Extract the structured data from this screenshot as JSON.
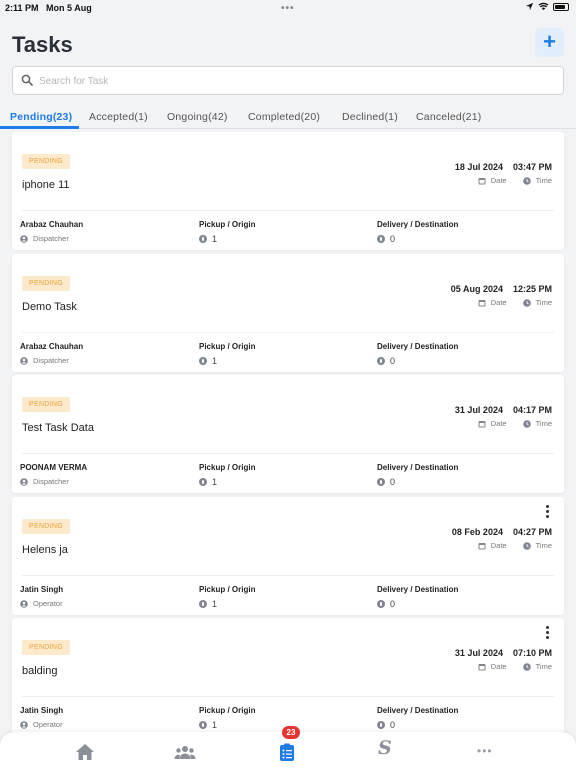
{
  "status_bar": {
    "time": "2:11 PM",
    "date": "Mon 5 Aug",
    "dots": "•••"
  },
  "header": {
    "title": "Tasks",
    "add_label": "+"
  },
  "search": {
    "placeholder": "Search for Task"
  },
  "tabs": [
    {
      "label": "Pending(23)",
      "active": true
    },
    {
      "label": "Accepted(1)"
    },
    {
      "label": "Ongoing(42)"
    },
    {
      "label": "Completed(20)"
    },
    {
      "label": "Declined(1)"
    },
    {
      "label": "Canceled(21)"
    }
  ],
  "labels": {
    "date": "Date",
    "time": "Time",
    "pickup": "Pickup / Origin",
    "delivery": "Delivery / Destination"
  },
  "tasks": [
    {
      "status": "PENDING",
      "name": "iphone 11",
      "date": "18 Jul 2024",
      "time": "03:47 PM",
      "person": "Arabaz Chauhan",
      "role": "Dispatcher",
      "pickup_count": "1",
      "delivery_count": "0",
      "has_menu": false
    },
    {
      "status": "PENDING",
      "name": "Demo Task",
      "date": "05 Aug 2024",
      "time": "12:25 PM",
      "person": "Arabaz Chauhan",
      "role": "Dispatcher",
      "pickup_count": "1",
      "delivery_count": "0",
      "has_menu": false
    },
    {
      "status": "PENDING",
      "name": "Test Task Data",
      "date": "31 Jul 2024",
      "time": "04:17 PM",
      "person": "POONAM VERMA",
      "role": "Dispatcher",
      "pickup_count": "1",
      "delivery_count": "0",
      "has_menu": false
    },
    {
      "status": "PENDING",
      "name": "Helens ja",
      "date": "08 Feb 2024",
      "time": "04:27 PM",
      "person": "Jatin Singh",
      "role": "Operator",
      "pickup_count": "1",
      "delivery_count": "0",
      "has_menu": true
    },
    {
      "status": "PENDING",
      "name": "balding",
      "date": "31 Jul 2024",
      "time": "07:10 PM",
      "person": "Jatin Singh",
      "role": "Operator",
      "pickup_count": "1",
      "delivery_count": "0",
      "has_menu": true
    }
  ],
  "bottom_nav": {
    "items": [
      "home-icon",
      "team-icon",
      "tasks-icon",
      "s-logo-icon",
      "more-icon"
    ],
    "tasks_badge": "23",
    "s_label": "S",
    "more_label": "•••"
  },
  "colors": {
    "accent": "#1f7be6",
    "pending_bg": "#fde9cc",
    "pending_text": "#e9a23b",
    "badge_red": "#e3342f"
  }
}
